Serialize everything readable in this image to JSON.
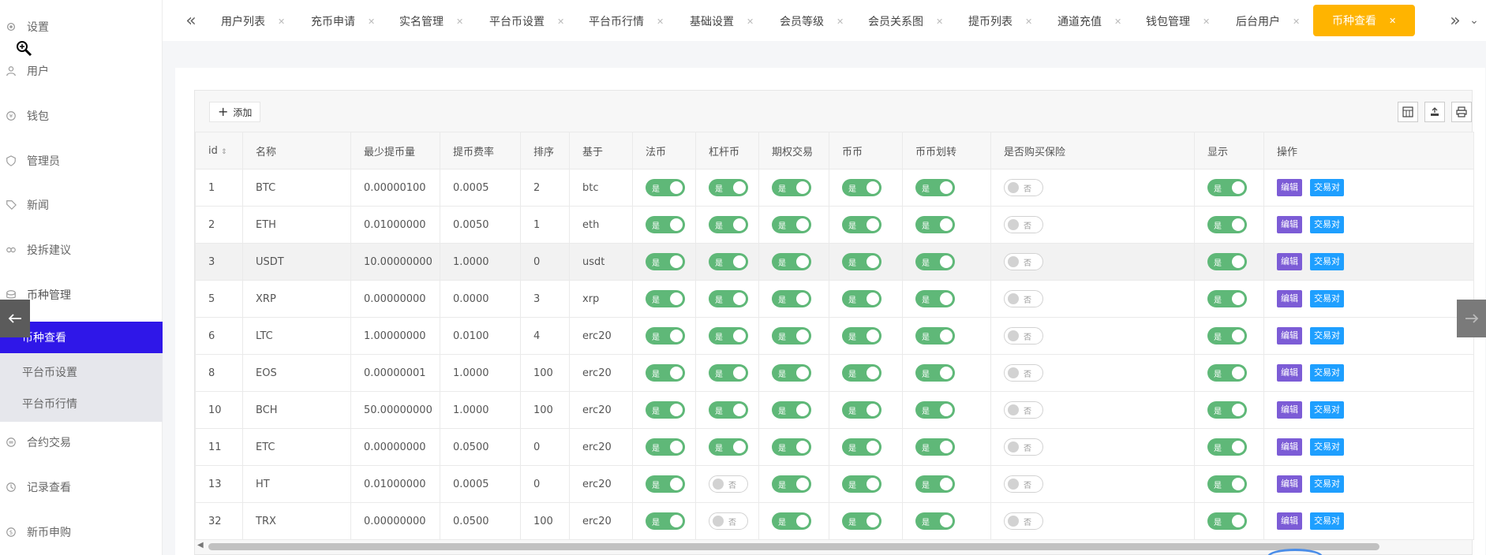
{
  "sidebar": {
    "items": [
      {
        "label": "设置",
        "icon": "gear-icon"
      },
      {
        "label": "用户",
        "icon": "user-icon"
      },
      {
        "label": "钱包",
        "icon": "wallet-icon"
      },
      {
        "label": "管理员",
        "icon": "shield-icon"
      },
      {
        "label": "新闻",
        "icon": "tag-icon"
      },
      {
        "label": "投拆建议",
        "icon": "link-icon"
      },
      {
        "label": "币种管理",
        "icon": "coin-icon"
      }
    ],
    "submenu": [
      {
        "label": "币种查看"
      },
      {
        "label": "平台币设置"
      },
      {
        "label": "平台币行情"
      }
    ],
    "items_after": [
      {
        "label": "合约交易",
        "icon": "exchange-icon"
      },
      {
        "label": "记录查看",
        "icon": "record-icon"
      },
      {
        "label": "新币申购",
        "icon": "dollar-icon"
      }
    ]
  },
  "tabs": [
    {
      "label": "用户列表"
    },
    {
      "label": "充币申请"
    },
    {
      "label": "实名管理"
    },
    {
      "label": "平台币设置"
    },
    {
      "label": "平台币行情"
    },
    {
      "label": "基础设置"
    },
    {
      "label": "会员等级"
    },
    {
      "label": "会员关系图"
    },
    {
      "label": "提币列表"
    },
    {
      "label": "通道充值"
    },
    {
      "label": "钱包管理"
    },
    {
      "label": "后台用户"
    },
    {
      "label": "币种查看"
    }
  ],
  "toolbar": {
    "add_label": "添加"
  },
  "table": {
    "headers": [
      "id",
      "名称",
      "最少提币量",
      "提币费率",
      "排序",
      "基于",
      "法币",
      "杠杆币",
      "期权交易",
      "币币",
      "币币划转",
      "是否购买保险",
      "显示",
      "操作"
    ],
    "on_label": "是",
    "off_label": "否",
    "edit_label": "编辑",
    "pair_label": "交易对",
    "rows": [
      {
        "id": "1",
        "name": "BTC",
        "min": "0.00000100",
        "fee": "0.0005",
        "sort": "2",
        "base": "btc",
        "fiat": true,
        "lever": true,
        "option": true,
        "coin": true,
        "transfer": true,
        "insurance": false,
        "show": true
      },
      {
        "id": "2",
        "name": "ETH",
        "min": "0.01000000",
        "fee": "0.0050",
        "sort": "1",
        "base": "eth",
        "fiat": true,
        "lever": true,
        "option": true,
        "coin": true,
        "transfer": true,
        "insurance": false,
        "show": true
      },
      {
        "id": "3",
        "name": "USDT",
        "min": "10.00000000",
        "fee": "1.0000",
        "sort": "0",
        "base": "usdt",
        "fiat": true,
        "lever": true,
        "option": true,
        "coin": true,
        "transfer": true,
        "insurance": false,
        "show": true
      },
      {
        "id": "5",
        "name": "XRP",
        "min": "0.00000000",
        "fee": "0.0000",
        "sort": "3",
        "base": "xrp",
        "fiat": true,
        "lever": true,
        "option": true,
        "coin": true,
        "transfer": true,
        "insurance": false,
        "show": true
      },
      {
        "id": "6",
        "name": "LTC",
        "min": "1.00000000",
        "fee": "0.0100",
        "sort": "4",
        "base": "erc20",
        "fiat": true,
        "lever": true,
        "option": true,
        "coin": true,
        "transfer": true,
        "insurance": false,
        "show": true
      },
      {
        "id": "8",
        "name": "EOS",
        "min": "0.00000001",
        "fee": "1.0000",
        "sort": "100",
        "base": "erc20",
        "fiat": true,
        "lever": true,
        "option": true,
        "coin": true,
        "transfer": true,
        "insurance": false,
        "show": true
      },
      {
        "id": "10",
        "name": "BCH",
        "min": "50.00000000",
        "fee": "1.0000",
        "sort": "100",
        "base": "erc20",
        "fiat": true,
        "lever": true,
        "option": true,
        "coin": true,
        "transfer": true,
        "insurance": false,
        "show": true
      },
      {
        "id": "11",
        "name": "ETC",
        "min": "0.00000000",
        "fee": "0.0500",
        "sort": "0",
        "base": "erc20",
        "fiat": true,
        "lever": true,
        "option": true,
        "coin": true,
        "transfer": true,
        "insurance": false,
        "show": true
      },
      {
        "id": "13",
        "name": "HT",
        "min": "0.01000000",
        "fee": "0.0005",
        "sort": "0",
        "base": "erc20",
        "fiat": true,
        "lever": false,
        "option": true,
        "coin": true,
        "transfer": true,
        "insurance": false,
        "show": true
      },
      {
        "id": "32",
        "name": "TRX",
        "min": "0.00000000",
        "fee": "0.0500",
        "sort": "100",
        "base": "erc20",
        "fiat": true,
        "lever": false,
        "option": true,
        "coin": true,
        "transfer": true,
        "insurance": false,
        "show": true
      }
    ]
  },
  "colors": {
    "sidebar_active": "#2f17e8",
    "tab_active": "#ffb400",
    "switch_on": "#5fb878",
    "edit_btn": "#7c5cd6",
    "pair_btn": "#1e9fff"
  }
}
